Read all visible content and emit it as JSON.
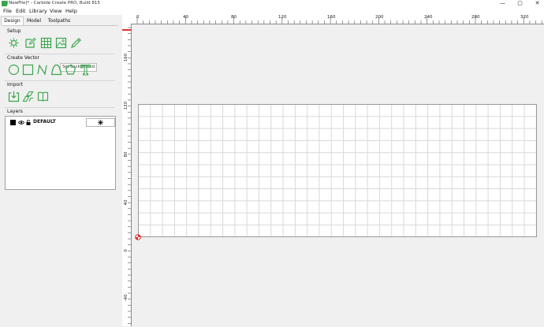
{
  "window": {
    "title": "[NewFile]* - Carbide Create PRO, Build 815",
    "controls": [
      "—",
      "▢",
      "✕"
    ]
  },
  "menu": {
    "items": [
      "File",
      "Edit",
      "Library",
      "View",
      "Help"
    ]
  },
  "left_panel": {
    "tabs": [
      "Design",
      "Model",
      "Toolpaths"
    ],
    "active_tab": "Design",
    "sections": {
      "setup": "Setup",
      "create_vector": "Create Vector",
      "import": "Import",
      "layers": "Layers"
    },
    "tooltip": "Set Background",
    "layers": [
      {
        "name": "DEFAULT",
        "color": "#000000"
      }
    ]
  },
  "ruler": {
    "top_labels": [
      "0",
      "40",
      "80",
      "120",
      "160",
      "200",
      "240",
      "280",
      "320"
    ],
    "left_labels": [
      "160",
      "120",
      "80",
      "40",
      "0",
      "-40"
    ]
  },
  "colors": {
    "accent_green": "#3aa64b",
    "origin_red": "#e03030"
  }
}
